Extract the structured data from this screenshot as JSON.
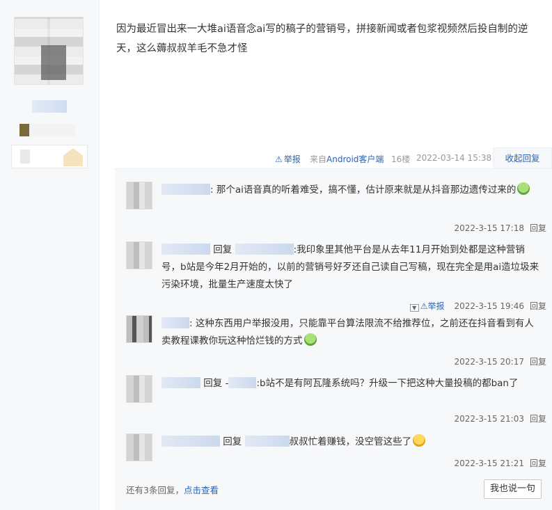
{
  "post": {
    "content": "因为最近冒出来一大堆ai语音念ai写的稿子的营销号，拼接新闻或者包浆视频然后投自制的逆天，这么薅叔叔羊毛不急才怪"
  },
  "tail": {
    "report_label": "举报",
    "from_prefix": "来自",
    "device": "Android客户端",
    "floor": "16楼",
    "time": "2022-03-14 15:38",
    "collapse_label": "收起回复"
  },
  "replies": [
    {
      "reply_to": "",
      "text": ": 那个ai语音真的听着难受，搞不懂，估计原来就是从抖音那边遗传过来的",
      "emoji": "green-face-emoji",
      "time": "2022-3-15 17:18",
      "reply_label": "回复"
    },
    {
      "reply_to": "回复",
      "text": ":我印象里其他平台是从去年11月开始到处都是这种营销号，b站是今年2月开始的，以前的营销号好歹还自己读自己写稿，现在完全是用ai造垃圾来污染环境，批量生产速度太快了",
      "emoji": "",
      "report_label": "举报",
      "time": "2022-3-15 19:46",
      "reply_label": "回复"
    },
    {
      "reply_to": "",
      "text": ": 这种东西用户举报没用，只能靠平台算法限流不给推荐位，之前还在抖音看到有人卖教程课教你玩这种恰烂钱的方式",
      "emoji": "green-face-emoji",
      "time": "2022-3-15 20:17",
      "reply_label": "回复"
    },
    {
      "reply_to": "回复 -",
      "text": ":b站不是有阿瓦隆系统吗？升级一下把这种大量投稿的都ban了",
      "emoji": "",
      "time": "2022-3-15 21:03",
      "reply_label": "回复"
    },
    {
      "reply_to": "回复",
      "text": "叔叔忙着赚钱，没空管这些了",
      "emoji": "yellow-face-emoji",
      "time": "2022-3-15 21:21",
      "reply_label": "回复"
    }
  ],
  "more": {
    "prefix": "还有3条回复，",
    "link": "点击查看"
  },
  "say_button": "我也说一句"
}
